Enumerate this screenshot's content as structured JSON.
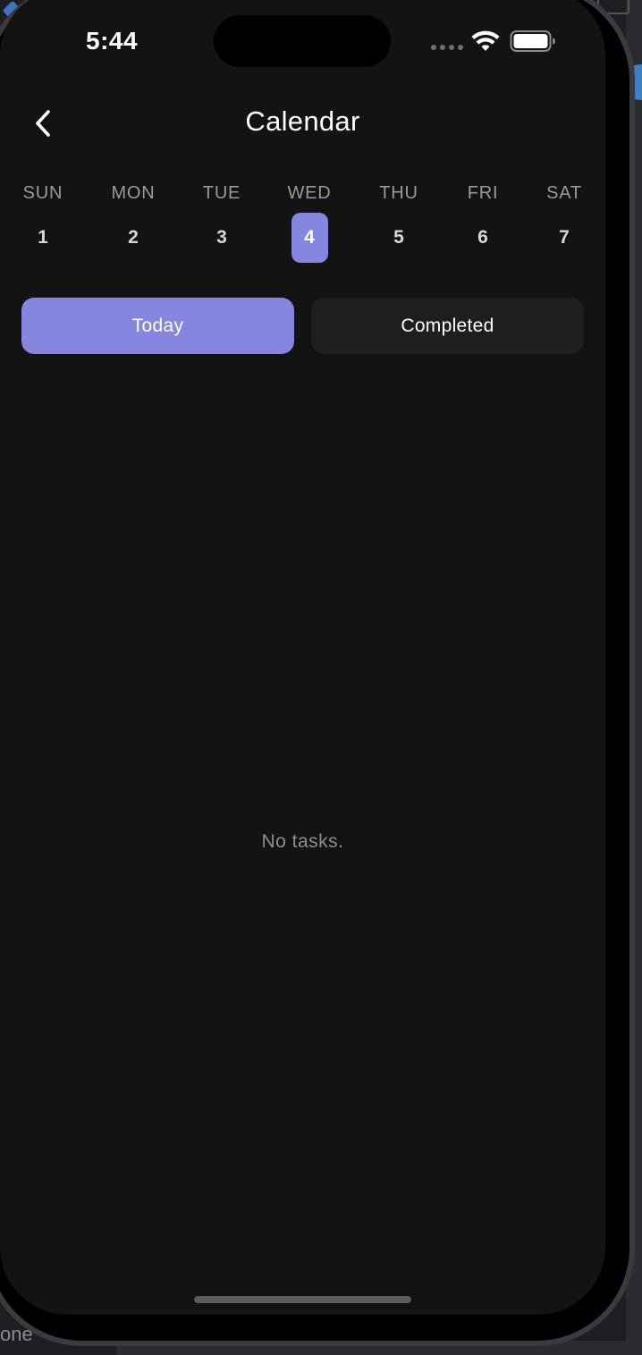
{
  "backdrop": {
    "partial_label": "one"
  },
  "status_bar": {
    "time": "5:44"
  },
  "header": {
    "title": "Calendar",
    "back_icon": "chevron-left-icon"
  },
  "week": {
    "days": [
      {
        "name": "SUN",
        "number": "1",
        "selected": false
      },
      {
        "name": "MON",
        "number": "2",
        "selected": false
      },
      {
        "name": "TUE",
        "number": "3",
        "selected": false
      },
      {
        "name": "WED",
        "number": "4",
        "selected": true
      },
      {
        "name": "THU",
        "number": "5",
        "selected": false
      },
      {
        "name": "FRI",
        "number": "6",
        "selected": false
      },
      {
        "name": "SAT",
        "number": "7",
        "selected": false
      }
    ]
  },
  "tabs": {
    "today_label": "Today",
    "completed_label": "Completed",
    "active": "Today"
  },
  "main": {
    "empty_message": "No tasks."
  },
  "colors": {
    "accent": "#8686e0",
    "background": "#131314",
    "inactive_tab": "#1e1e20",
    "muted_text": "#9a9a9e"
  }
}
